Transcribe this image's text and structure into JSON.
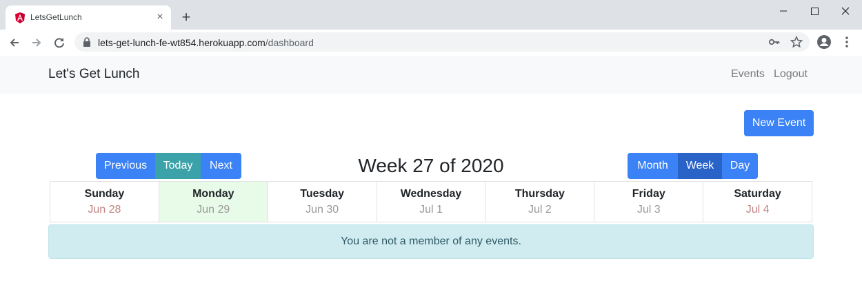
{
  "browser": {
    "tab_title": "LetsGetLunch",
    "url_host": "lets-get-lunch-fe-wt854.herokuapp.com",
    "url_path": "/dashboard",
    "icons": [
      "angular-favicon-icon",
      "close-icon",
      "plus-icon",
      "minimize-icon",
      "maximize-icon",
      "window-close-icon",
      "back-icon",
      "forward-icon",
      "reload-icon",
      "lock-icon",
      "key-icon",
      "star-icon",
      "profile-icon",
      "menu-icon"
    ]
  },
  "navbar": {
    "brand": "Let's Get Lunch",
    "links": [
      "Events",
      "Logout"
    ]
  },
  "actions": {
    "new_event": "New Event"
  },
  "calendar_nav": {
    "previous": "Previous",
    "today": "Today",
    "next": "Next",
    "title": "Week 27 of 2020",
    "views": [
      "Month",
      "Week",
      "Day"
    ],
    "active_view": "Week"
  },
  "week": [
    {
      "name": "Sunday",
      "date": "Jun 28"
    },
    {
      "name": "Monday",
      "date": "Jun 29"
    },
    {
      "name": "Tuesday",
      "date": "Jun 30"
    },
    {
      "name": "Wednesday",
      "date": "Jul 1"
    },
    {
      "name": "Thursday",
      "date": "Jul 2"
    },
    {
      "name": "Friday",
      "date": "Jul 3"
    },
    {
      "name": "Saturday",
      "date": "Jul 4"
    }
  ],
  "alert": {
    "message": "You are not a member of any events."
  },
  "colors": {
    "primary": "#3b82f6",
    "today_button": "#3aa2a8",
    "active_view": "#2a63c7",
    "today_column": "#e8fbe8",
    "alert_bg": "#d1ecf1"
  }
}
